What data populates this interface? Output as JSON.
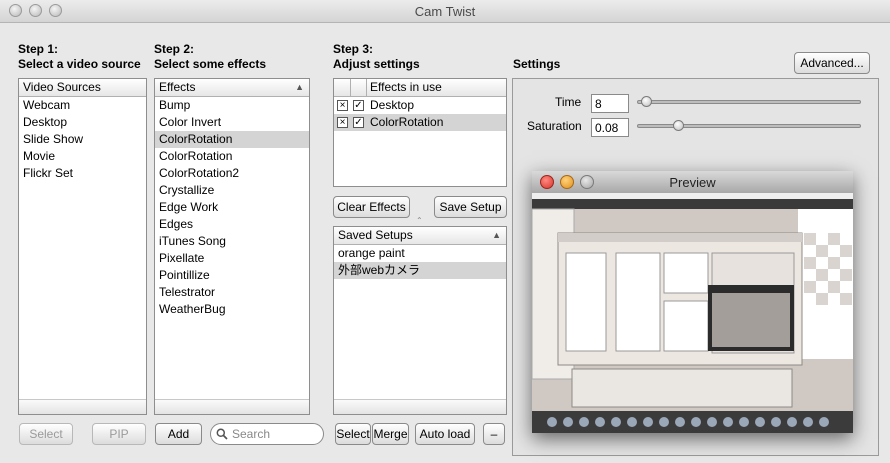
{
  "window": {
    "title": "Cam Twist"
  },
  "step1": {
    "line1": "Step 1:",
    "line2": "Select a video source",
    "header": "Video Sources",
    "items": [
      "Webcam",
      "Desktop",
      "Slide Show",
      "Movie",
      "Flickr Set"
    ],
    "select_label": "Select",
    "pip_label": "PIP"
  },
  "step2": {
    "line1": "Step 2:",
    "line2": "Select some effects",
    "header": "Effects",
    "items": [
      "Bump",
      "Color Invert",
      "ColorRotation",
      "ColorRotation",
      "ColorRotation2",
      "Crystallize",
      "Edge Work",
      "Edges",
      "iTunes Song",
      "Pixellate",
      "Pointillize",
      "Telestrator",
      "WeatherBug"
    ],
    "selected_index": 2,
    "add_label": "Add",
    "search_placeholder": "Search"
  },
  "step3": {
    "line1": "Step 3:",
    "line2": "Adjust settings",
    "header": "Effects in use",
    "items": [
      "Desktop",
      "ColorRotation"
    ],
    "clear_label": "Clear Effects",
    "save_label": "Save Setup",
    "saved_header": "Saved Setups",
    "saved_items": [
      "orange paint",
      "外部webカメラ"
    ],
    "select_label": "Select",
    "merge_label": "Merge",
    "autoload_label": "Auto load",
    "remove_label": "–"
  },
  "settings": {
    "title": "Settings",
    "advanced_label": "Advanced...",
    "time_label": "Time",
    "time_value": "8",
    "time_fraction": 0.02,
    "saturation_label": "Saturation",
    "saturation_value": "0.08",
    "saturation_fraction": 0.17
  },
  "preview": {
    "title": "Preview"
  },
  "icons": {
    "check": "checkmark-icon",
    "remove": "x-box-icon",
    "search": "magnifier-icon",
    "sort": "sort-up-triangle-icon"
  },
  "colors": {
    "selection": "#d4d4d4",
    "close": "#e0443e",
    "minimize": "#f0a42c"
  }
}
